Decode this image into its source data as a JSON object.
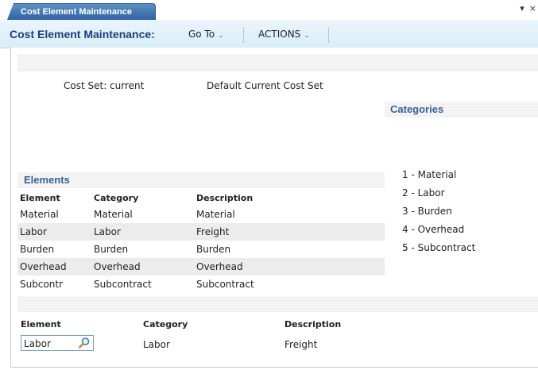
{
  "tab": {
    "title": "Cost Element Maintenance",
    "menu_glyph": "▾",
    "close_glyph": "×"
  },
  "toolbar": {
    "title": "Cost Element Maintenance:",
    "goto_label": "Go To",
    "actions_label": "ACTIONS",
    "caret": "⌄"
  },
  "cost_set": {
    "label": "Cost Set: current",
    "description": "Default Current Cost Set"
  },
  "categories": {
    "header": "Categories",
    "items": [
      "1 - Material",
      "2 - Labor",
      "3 - Burden",
      "4 - Overhead",
      "5 - Subcontract"
    ]
  },
  "elements": {
    "header": "Elements",
    "columns": [
      "Element",
      "Category",
      "Description"
    ],
    "rows": [
      [
        "Material",
        "Material",
        "Material"
      ],
      [
        "Labor",
        "Labor",
        "Freight"
      ],
      [
        "Burden",
        "Burden",
        "Burden"
      ],
      [
        "Overhead",
        "Overhead",
        "Overhead"
      ],
      [
        "Subcontr",
        "Subcontract",
        "Subcontract"
      ]
    ]
  },
  "detail": {
    "element_label": "Element",
    "category_label": "Category",
    "description_label": "Description",
    "element_value": "Labor",
    "category_value": "Labor",
    "description_value": "Freight"
  },
  "colors": {
    "accent": "#3a5f94",
    "tab": "#2f62a1",
    "alt_row": "#ececec"
  }
}
